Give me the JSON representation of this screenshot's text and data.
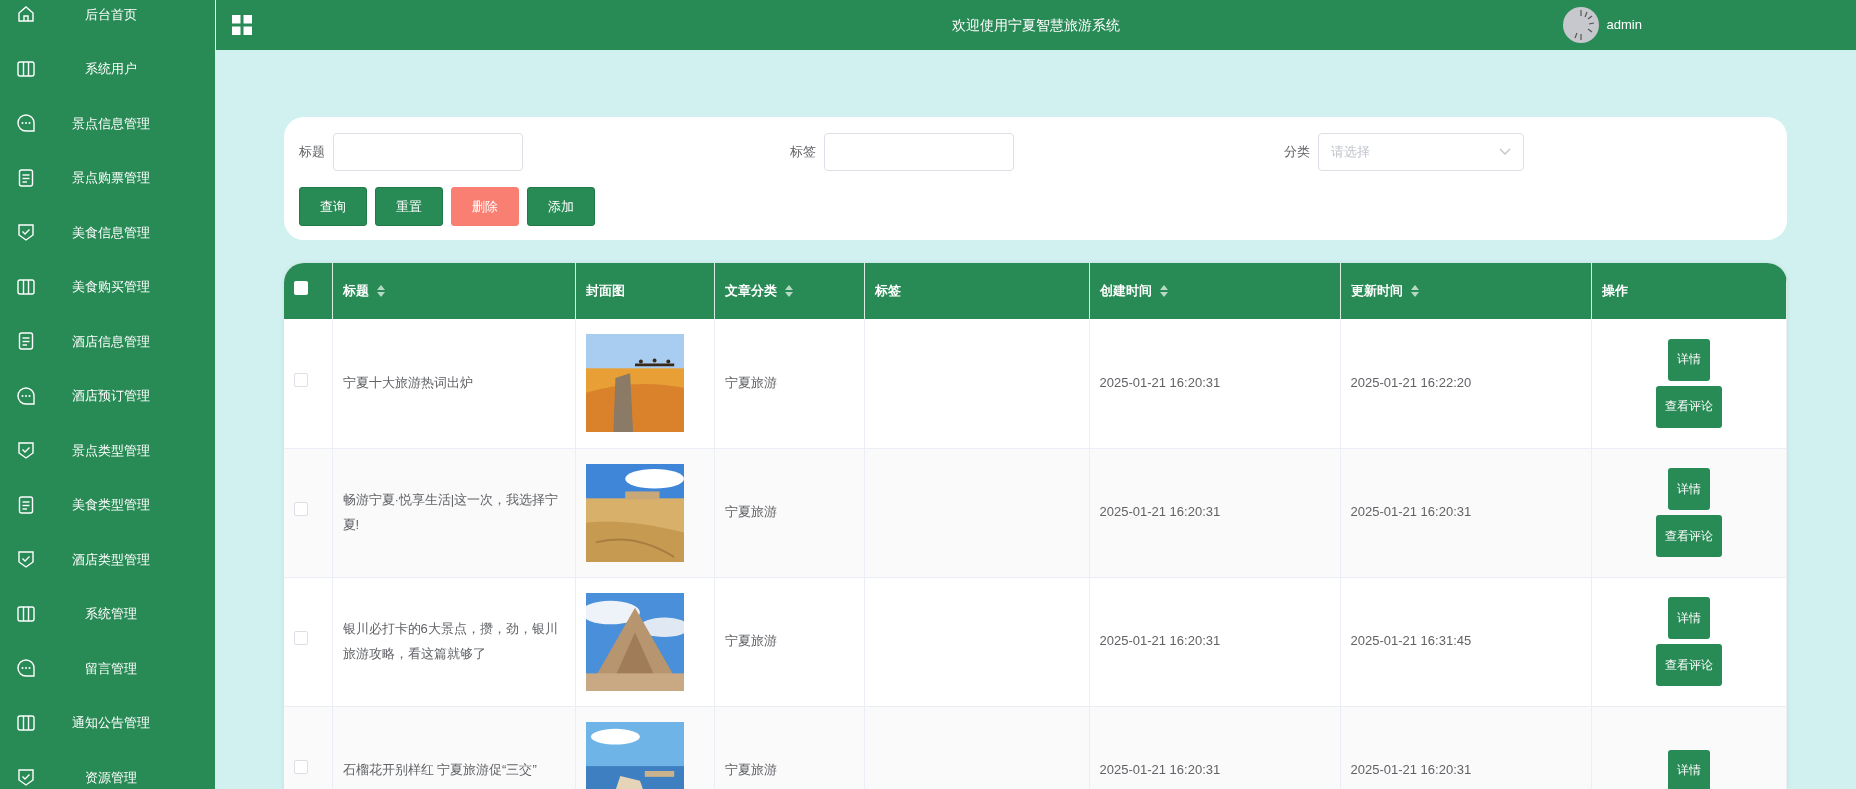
{
  "sidebar": {
    "items": [
      {
        "label": "后台首页"
      },
      {
        "label": "系统用户"
      },
      {
        "label": "景点信息管理"
      },
      {
        "label": "景点购票管理"
      },
      {
        "label": "美食信息管理"
      },
      {
        "label": "美食购买管理"
      },
      {
        "label": "酒店信息管理"
      },
      {
        "label": "酒店预订管理"
      },
      {
        "label": "景点类型管理"
      },
      {
        "label": "美食类型管理"
      },
      {
        "label": "酒店类型管理"
      },
      {
        "label": "系统管理"
      },
      {
        "label": "留言管理"
      },
      {
        "label": "通知公告管理"
      },
      {
        "label": "资源管理"
      }
    ]
  },
  "header": {
    "title": "欢迎使用宁夏智慧旅游系统",
    "user": "admin"
  },
  "search": {
    "fields": [
      {
        "label": "标题",
        "kind": "input"
      },
      {
        "label": "标签",
        "kind": "input"
      },
      {
        "label": "分类",
        "kind": "select",
        "placeholder": "请选择"
      }
    ],
    "buttons": [
      {
        "label": "查询",
        "kind": "primary"
      },
      {
        "label": "重置",
        "kind": "primary"
      },
      {
        "label": "删除",
        "kind": "danger"
      },
      {
        "label": "添加",
        "kind": "primary"
      }
    ]
  },
  "table": {
    "select_all_checked": false,
    "columns": [
      {
        "label": "标题",
        "sortable": true
      },
      {
        "label": "封面图",
        "sortable": false
      },
      {
        "label": "文章分类",
        "sortable": true
      },
      {
        "label": "标签",
        "sortable": false
      },
      {
        "label": "创建时间",
        "sortable": true
      },
      {
        "label": "更新时间",
        "sortable": true
      },
      {
        "label": "操作",
        "sortable": false
      }
    ],
    "rows": [
      {
        "checked": false,
        "title": "宁夏十大旅游热词出炉",
        "cover": {
          "kind": "picture"
        },
        "category": "宁夏旅游",
        "created": "2025-01-21 16:20:31",
        "updated": "2025-01-21 16:22:20",
        "actions": [
          "详情",
          "查看评论"
        ]
      },
      {
        "checked": false,
        "title": "畅游宁夏·悦享生活|这一次，我选择宁夏!",
        "cover": {
          "kind": "picture"
        },
        "category": "宁夏旅游",
        "created": "2025-01-21 16:20:31",
        "updated": "2025-01-21 16:20:31",
        "actions": [
          "详情",
          "查看评论"
        ]
      },
      {
        "checked": false,
        "title": "银川必打卡的6大景点，攒，劲，银川旅游攻略，看这篇就够了",
        "cover": {
          "kind": "picture"
        },
        "category": "宁夏旅游",
        "created": "2025-01-21 16:20:31",
        "updated": "2025-01-21 16:31:45",
        "actions": [
          "详情",
          "查看评论"
        ]
      },
      {
        "checked": false,
        "title": "石榴花开别样红 宁夏旅游促“三交”",
        "cover": {
          "kind": "picture"
        },
        "category": "宁夏旅游",
        "created": "2025-01-21 16:20:31",
        "updated": "2025-01-21 16:20:31",
        "actions": [
          "详情"
        ]
      }
    ]
  }
}
